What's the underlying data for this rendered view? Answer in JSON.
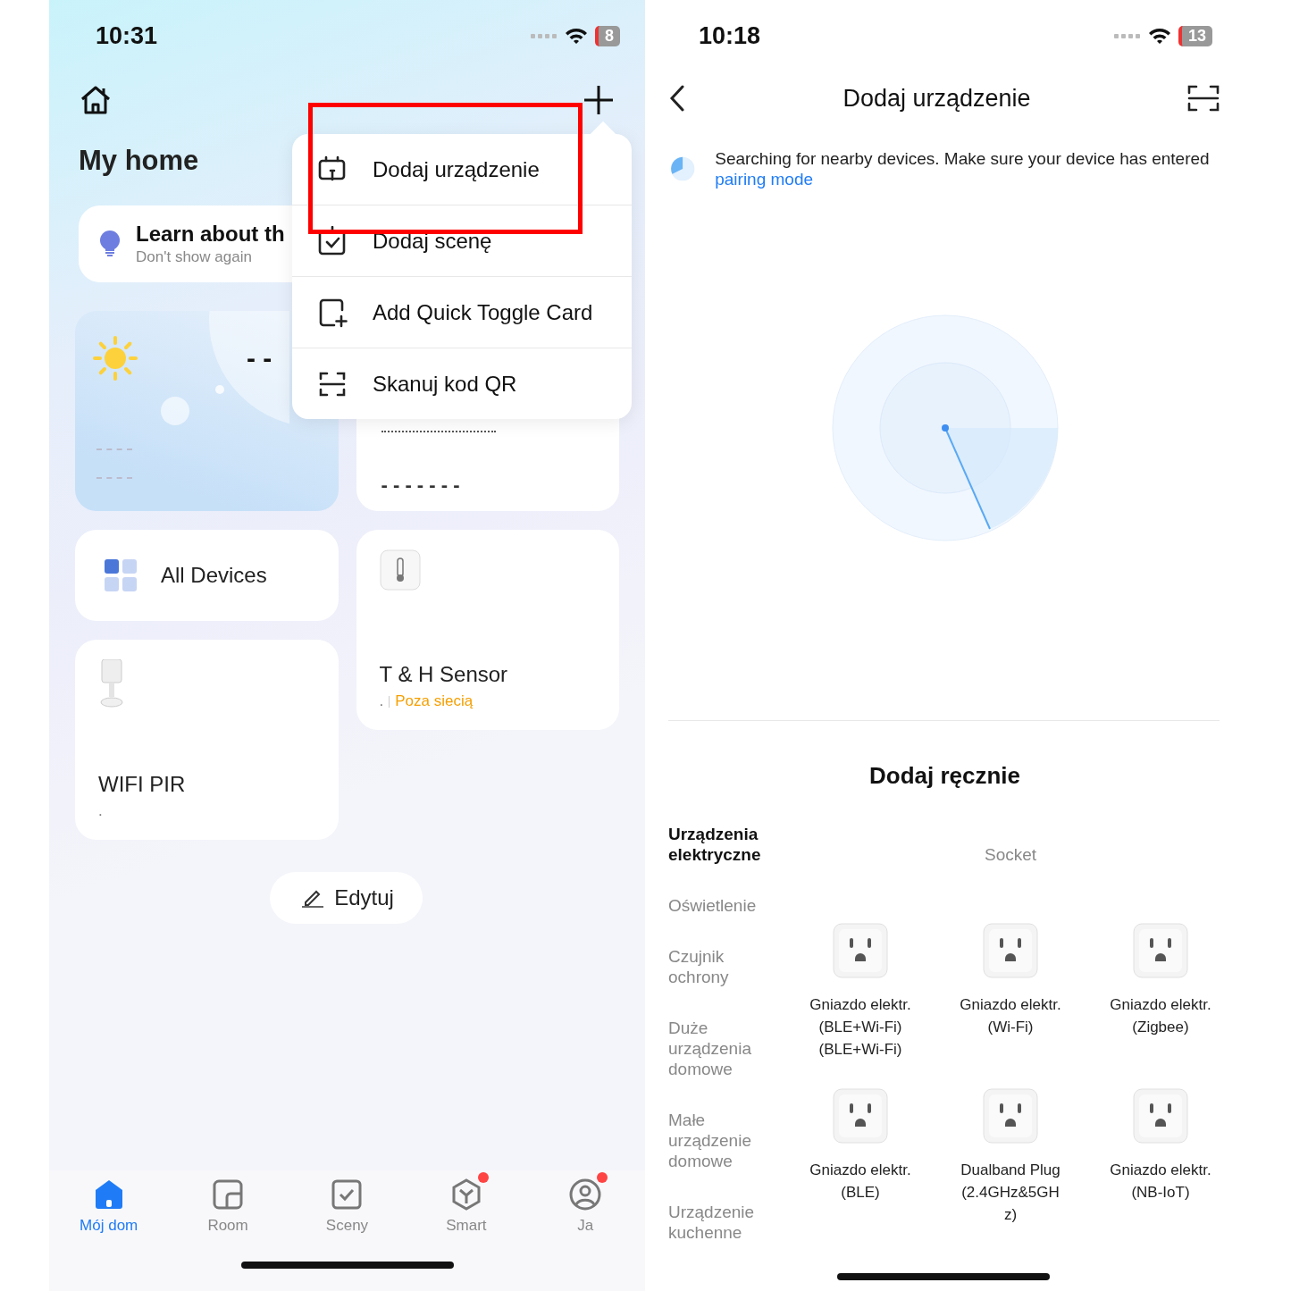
{
  "left": {
    "status": {
      "time": "10:31",
      "battery": "8"
    },
    "home_title": "My home",
    "tip": {
      "title": "Learn about th",
      "action": "Don't show again"
    },
    "weather": {
      "temperature": "- -"
    },
    "summary_card": {
      "value": "- - - - - - -"
    },
    "devices": [
      {
        "kind": "all",
        "name": "All Devices"
      },
      {
        "kind": "sensor",
        "name": "T & H Sensor",
        "room": ".",
        "status": "Poza siecią",
        "online": false
      },
      {
        "kind": "pir",
        "name": "WIFI PIR",
        "room": "."
      }
    ],
    "edit_button": "Edytuj",
    "menu": [
      {
        "label": "Dodaj urządzenie",
        "kind": "device",
        "highlighted": true
      },
      {
        "label": "Dodaj scenę",
        "kind": "scene",
        "highlighted": false
      },
      {
        "label": "Add Quick Toggle Card",
        "kind": "card",
        "highlighted": false
      },
      {
        "label": "Skanuj kod QR",
        "kind": "scan",
        "highlighted": false
      }
    ],
    "tabs": [
      {
        "label": "Mój dom",
        "kind": "home",
        "selected": true,
        "badge": false
      },
      {
        "label": "Room",
        "kind": "room",
        "selected": false,
        "badge": false
      },
      {
        "label": "Sceny",
        "kind": "scene",
        "selected": false,
        "badge": false
      },
      {
        "label": "Smart",
        "kind": "smart",
        "selected": false,
        "badge": true
      },
      {
        "label": "Ja",
        "kind": "me",
        "selected": false,
        "badge": true
      }
    ]
  },
  "right": {
    "status": {
      "time": "10:18",
      "battery": "13"
    },
    "title": "Dodaj urządzenie",
    "notice": {
      "text": "Searching for nearby devices. Make sure your device has entered",
      "link": "pairing mode"
    },
    "manual_title": "Dodaj ręcznie",
    "categories": [
      {
        "label": "Urządzenia elektryczne",
        "selected": true
      },
      {
        "label": "Oświetlenie",
        "selected": false
      },
      {
        "label": "Czujnik ochrony",
        "selected": false
      },
      {
        "label": "Duże urządzenia domowe",
        "selected": false
      },
      {
        "label": "Małe urządzenie domowe",
        "selected": false
      },
      {
        "label": "Urządzenie kuchenne",
        "selected": false
      }
    ],
    "group_title": "Socket",
    "products": [
      {
        "name": "Gniazdo elektr. (BLE+Wi-Fi) (BLE+Wi-Fi)"
      },
      {
        "name": "Gniazdo elektr. (Wi-Fi)"
      },
      {
        "name": "Gniazdo elektr. (Zigbee)"
      },
      {
        "name": "Gniazdo elektr. (BLE)"
      },
      {
        "name": "Dualband Plug (2.4GHz&5GHz)"
      },
      {
        "name": "Gniazdo elektr. (NB-IoT)"
      }
    ]
  }
}
